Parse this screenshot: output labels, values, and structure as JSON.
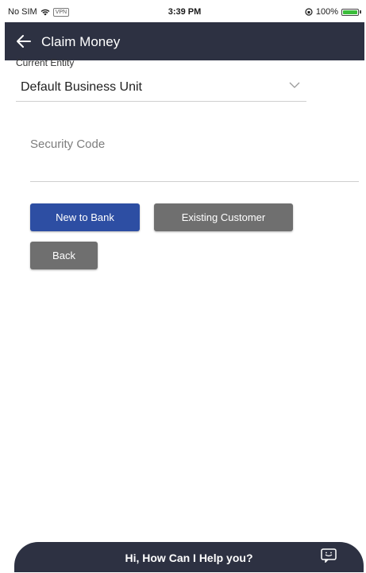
{
  "status_bar": {
    "carrier": "No SIM",
    "vpn": "VPN",
    "time": "3:39 PM",
    "battery": "100%",
    "battery_level": 1.0
  },
  "header": {
    "title": "Claim Money",
    "back_icon": "back-arrow-icon"
  },
  "entity": {
    "label": "Current Entity",
    "value": "Default Business Unit",
    "icon": "chevron-down-icon"
  },
  "security": {
    "placeholder": "Security Code",
    "value": ""
  },
  "buttons": {
    "new_to_bank": "New to Bank",
    "existing_customer": "Existing Customer",
    "back": "Back"
  },
  "chat": {
    "label": "Hi, How Can I Help you?",
    "icon": "chat-icon"
  },
  "colors": {
    "header_bg": "#2d3142",
    "primary_button": "#2d4ea3",
    "secondary_button": "#6f6f6f",
    "battery": "#3bbd3b"
  }
}
